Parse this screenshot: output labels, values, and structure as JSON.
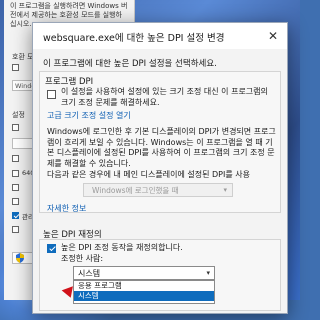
{
  "background_window": {
    "intro": "이 프로그램을 실행하려면 Windows 버전에서 제공하는 호환성 모드를 실행하십시오.",
    "compat_mode_label": "호환 모드",
    "compat_value": "Windows",
    "settings_label": "설정",
    "res_label": "640 x",
    "color_label": "관리자"
  },
  "dialog": {
    "title": "websquare.exe에 대한 높은 DPI 설정 변경",
    "description": "이 프로그램에 대한 높은 DPI 설정을 선택하세요.",
    "program_dpi": {
      "title": "프로그램 DPI",
      "checkbox_checked": false,
      "checkbox_text": "이 설정을 사용하여 설정에 있는 크기 조정 대신 이 프로그램의 크기 조정 문제를 해결하세요.",
      "link": "고급 크기 조정 설정 열기",
      "para1": "Windows에 로그인한 후 기본 디스플레이의 DPI가 변경되면 프로그램이 흐리게 보일 수 있습니다. Windows는 이 프로그램을 열 때 기본 디스플레이에 설정된 DPI를 사용하여 이 프로그램의 크기 조정 문제를 해결할 수 있습니다.",
      "para2": "다음과 같은 경우에 내 메인 디스플레이에 설정된 DPI를 사용",
      "dropdown_value": "Windows에 로그인했을 때",
      "details_link": "자세한 정보"
    },
    "override": {
      "title": "높은 DPI 재정의",
      "checkbox_checked": true,
      "checkbox_text": "높은 DPI 조정 동작을 재정의합니다.",
      "scaling_label": "조정한 사람:",
      "selected": "시스템",
      "options": [
        "응용 프로그램",
        "시스템"
      ],
      "highlighted_index": 1
    }
  },
  "icons": {
    "close": "close-icon",
    "dropdown_arrow": "chevron-down-icon",
    "shield": "uac-shield-icon",
    "pointer": "mouse-pointer-icon"
  },
  "colors": {
    "accent": "#0f6cbd",
    "link": "#0f5fb3"
  }
}
